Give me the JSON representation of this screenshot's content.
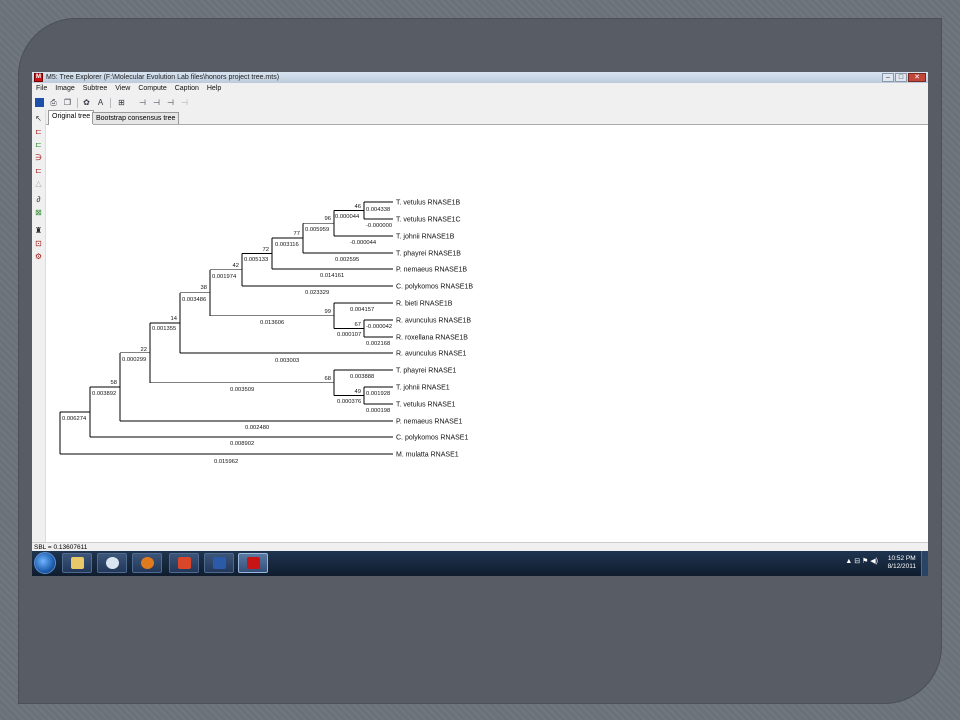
{
  "window": {
    "title": "M5: Tree Explorer (F:\\Molecular Evolution Lab files\\honors project tree.mts)"
  },
  "menu": [
    "File",
    "Image",
    "Subtree",
    "View",
    "Compute",
    "Caption",
    "Help"
  ],
  "tabs": [
    "Original tree",
    "Bootstrap consensus tree"
  ],
  "tree": {
    "taxa": [
      "T. vetulus RNASE1B",
      "T. vetulus RNASE1C",
      "T. johnii RNASE1B",
      "T. phayrei RNASE1B",
      "P. nemaeus RNASE1B",
      "C. polykomos RNASE1B",
      "R. bieti RNASE1B",
      "R. avunculus RNASE1B",
      "R. roxellana RNASE1B",
      "R. avunculus RNASE1",
      "T. phayrei RNASE1",
      "T. johnii RNASE1",
      "T. vetulus RNASE1",
      "P. nemaeus RNASE1",
      "C. polykomos RNASE1",
      "M. mulatta RNASE1"
    ],
    "branch_lengths": [
      "0.004338",
      "-0.000000",
      "0.000044",
      "-0.000044",
      "0.005959",
      "0.002595",
      "0.003116",
      "0.005133",
      "0.014161",
      "0.001974",
      "0.023329",
      "0.004157",
      "-0.000042",
      "0.000107",
      "0.002168",
      "0.013606",
      "0.003486",
      "0.003003",
      "0.001355",
      "0.003888",
      "0.001928",
      "0.000376",
      "0.000198",
      "0.003509",
      "0.000299",
      "0.002480",
      "0.003892",
      "0.008902",
      "0.006274",
      "0.015962"
    ],
    "bootstrap": [
      "46",
      "96",
      "77",
      "72",
      "42",
      "38",
      "99",
      "67",
      "14",
      "22",
      "68",
      "49",
      "58"
    ]
  },
  "status": {
    "sbl": "SBL = 0.13607611"
  },
  "taskbar": {
    "time": "10:52 PM",
    "date": "8/12/2011"
  },
  "colors": {
    "tree_line": "#000000",
    "app_red": "#c81414",
    "slide_frame": "#585d65"
  }
}
